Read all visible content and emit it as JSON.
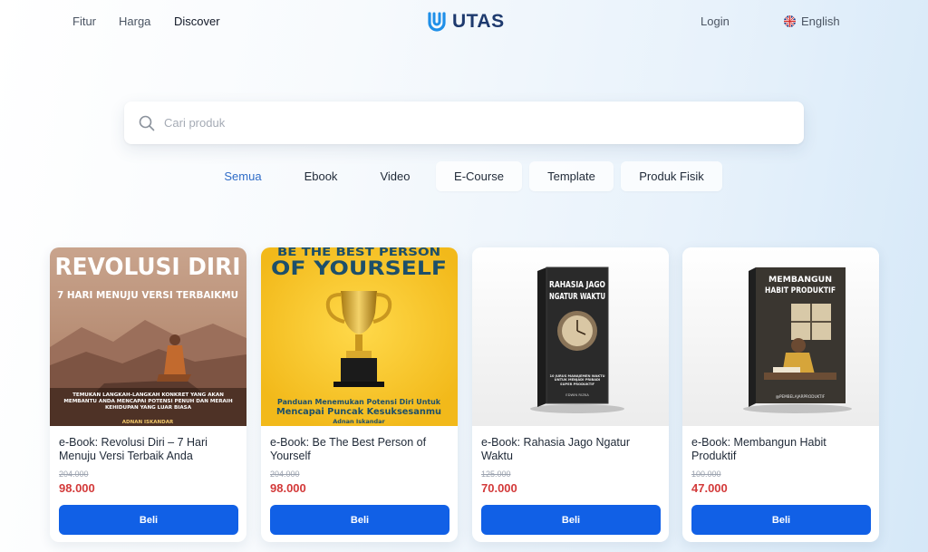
{
  "nav": {
    "links": [
      "Fitur",
      "Harga",
      "Discover"
    ],
    "logo_text": "UTAS",
    "login": "Login",
    "language": "English"
  },
  "search": {
    "placeholder": "Cari produk",
    "value": ""
  },
  "tabs": [
    {
      "label": "Semua",
      "active": true
    },
    {
      "label": "Ebook"
    },
    {
      "label": "Video"
    },
    {
      "label": "E-Course"
    },
    {
      "label": "Template"
    },
    {
      "label": "Produk Fisik"
    }
  ],
  "products": [
    {
      "title": "e-Book: Revolusi Diri – 7 Hari Menuju Versi Terbaik Anda",
      "old_price": "204.000",
      "price": "98.000",
      "buy_label": "Beli",
      "cover": {
        "headline": "REVOLUSI DIRI",
        "subheadline": "7 HARI MENUJU VERSI TERBAIKMU",
        "body": "TEMUKAN LANGKAH-LANGKAH KONKRET YANG AKAN MEMBANTU ANDA MENCAPAI POTENSI PENUH DAN MERAIH KEHIDUPAN YANG LUAR BIASA",
        "author": "ADNAN ISKANDAR"
      }
    },
    {
      "title": "e-Book: Be The Best Person of Yourself",
      "old_price": "204.000",
      "price": "98.000",
      "buy_label": "Beli",
      "cover": {
        "line1": "BE THE BEST PERSON",
        "line2": "OF YOURSELF",
        "body1": "Panduan Menemukan Potensi Diri Untuk",
        "body2": "Mencapai Puncak Kesuksesanmu",
        "author": "Adnan Iskandar"
      }
    },
    {
      "title": "e-Book: Rahasia Jago Ngatur Waktu",
      "old_price": "125.000",
      "price": "70.000",
      "buy_label": "Beli",
      "cover": {
        "line1": "RAHASIA JAGO",
        "line2": "NGATUR WAKTU",
        "body": "10 JURUS MANAJEMEN WAKTU UNTUK MENJADI PRIBADI SUPER PRODUKTIF",
        "author": "EDWIN RIZKA"
      }
    },
    {
      "title": "e-Book: Membangun Habit Produktif",
      "old_price": "100.000",
      "price": "47.000",
      "buy_label": "Beli",
      "cover": {
        "line1": "MEMBANGUN",
        "line2": "HABIT PRODUKTIF",
        "author": "@PEMBELAJARPRODUKTIF"
      }
    }
  ],
  "colors": {
    "accent": "#1160e6",
    "price": "#d33a3a",
    "active_tab": "#2f6cc7",
    "logo": "#1e3a6e"
  }
}
